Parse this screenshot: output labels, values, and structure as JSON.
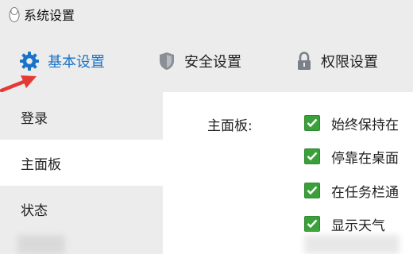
{
  "window": {
    "title": "系统设置",
    "logo_icon": "penguin-icon"
  },
  "tabs": [
    {
      "label": "基本设置",
      "icon": "gear-icon",
      "active": true,
      "color": "#1a73c8"
    },
    {
      "label": "安全设置",
      "icon": "shield-icon",
      "active": false
    },
    {
      "label": "权限设置",
      "icon": "lock-icon",
      "active": false
    }
  ],
  "sidebar": {
    "items": [
      {
        "label": "登录",
        "active": false
      },
      {
        "label": "主面板",
        "active": true
      },
      {
        "label": "状态",
        "active": false
      }
    ]
  },
  "main": {
    "section_label": "主面板:",
    "options": [
      {
        "label": "始终保持在",
        "checked": true
      },
      {
        "label": "停靠在桌面",
        "checked": true
      },
      {
        "label": "在任务栏通",
        "checked": true
      },
      {
        "label": "显示天气",
        "checked": true
      }
    ]
  },
  "annotation": {
    "arrow_color": "#e53935",
    "icon": "red-arrow-icon"
  },
  "colors": {
    "accent": "#1a73c8",
    "checkbox": "#3aa13a",
    "panel_bg": "#ececec"
  }
}
